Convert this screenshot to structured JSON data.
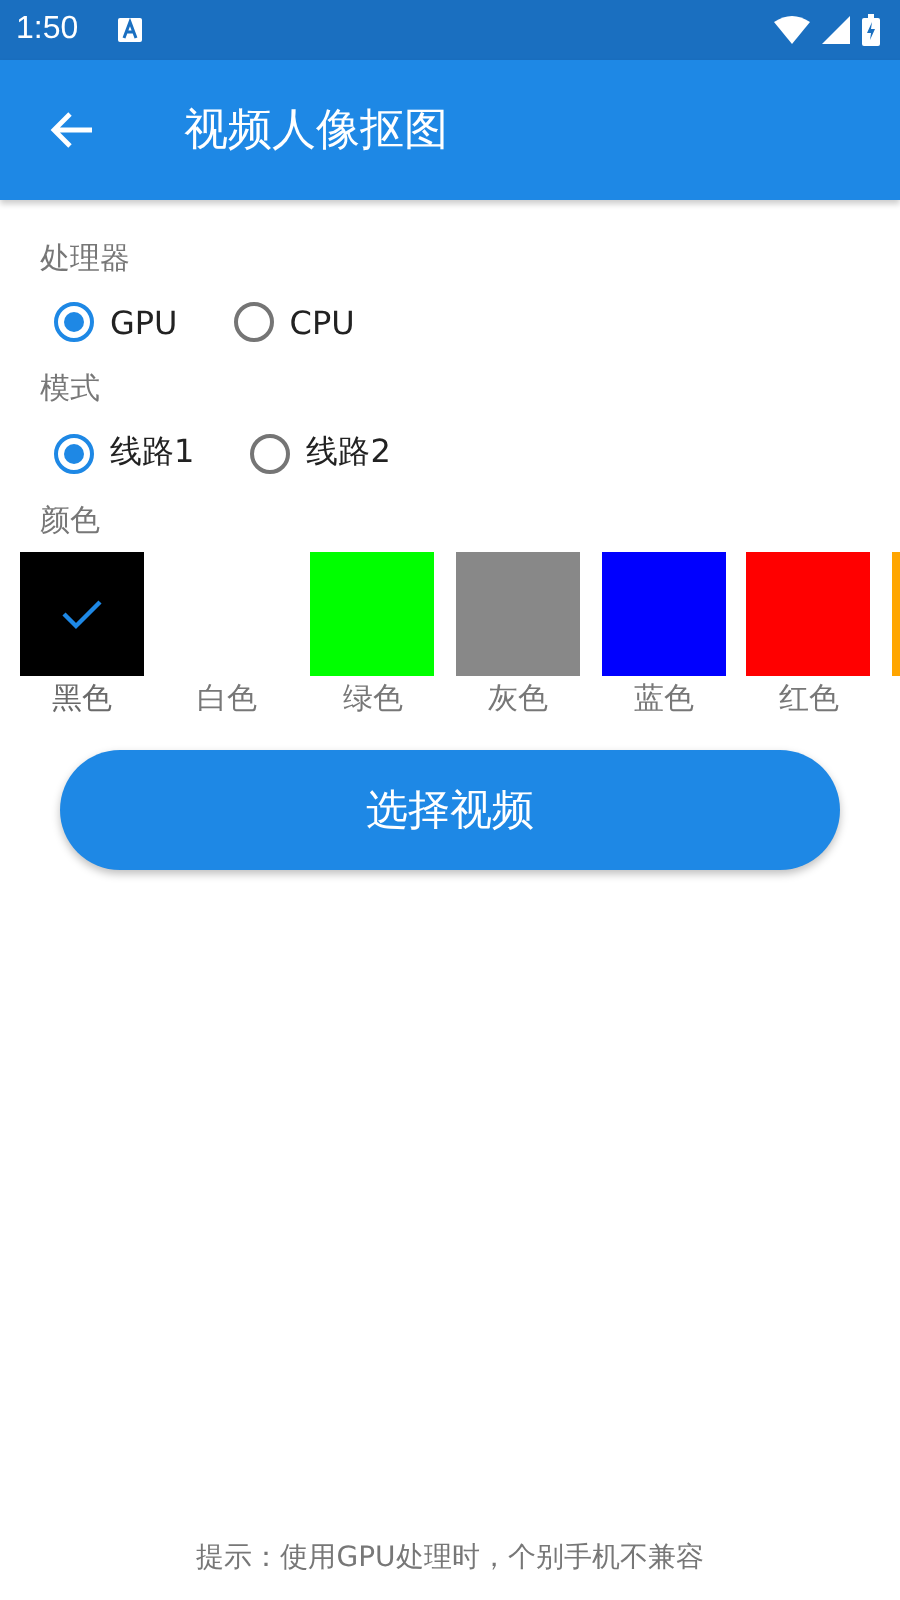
{
  "status_bar": {
    "time": "1:50"
  },
  "app_bar": {
    "title": "视频人像抠图"
  },
  "sections": [
    {
      "label": "处理器",
      "options": [
        {
          "label": "GPU",
          "selected": true
        },
        {
          "label": "CPU",
          "selected": false
        }
      ]
    },
    {
      "label": "模式",
      "options": [
        {
          "label": "线路1",
          "selected": true
        },
        {
          "label": "线路2",
          "selected": false
        }
      ]
    }
  ],
  "colors": {
    "label": "颜色",
    "items": [
      {
        "label": "黑色",
        "color": "#000000",
        "selected": true
      },
      {
        "label": "白色",
        "color": "#ffffff",
        "selected": false
      },
      {
        "label": "绿色",
        "color": "#00ff00",
        "selected": false
      },
      {
        "label": "灰色",
        "color": "#888888",
        "selected": false
      },
      {
        "label": "蓝色",
        "color": "#0000ff",
        "selected": false
      },
      {
        "label": "红色",
        "color": "#ff0000",
        "selected": false
      },
      {
        "color": "#ffa500"
      }
    ]
  },
  "button": "选择视频",
  "hint": "提示：使用GPU处理时，个别手机不兼容"
}
